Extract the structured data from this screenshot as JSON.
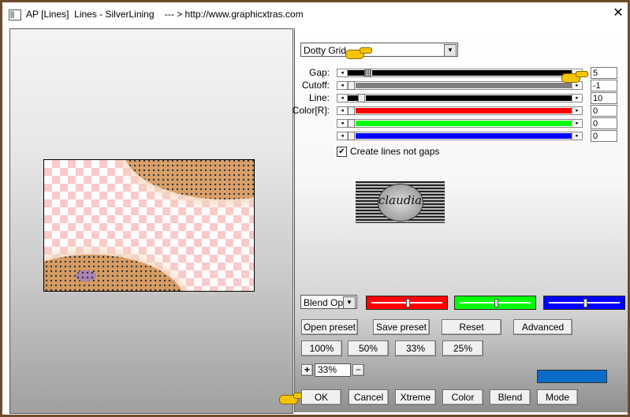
{
  "window": {
    "title": "AP [Lines]  Lines - SilverLining    --- > http://www.graphicxtras.com",
    "close_glyph": "✕"
  },
  "effect_select": {
    "value": "Dotty Grid"
  },
  "sliders": [
    {
      "label": "Gap:",
      "value": "5",
      "fill_color": "#000000",
      "position": 0.08
    },
    {
      "label": "Cutoff:",
      "value": "-1",
      "fill_color": "#808080",
      "position": 0.0
    },
    {
      "label": "Line:",
      "value": "10",
      "fill_color": "#000000",
      "position": 0.05
    },
    {
      "label": "Color[R]:",
      "value": "0",
      "fill_color": "#ff0000",
      "position": 0.0
    },
    {
      "label": "",
      "value": "0",
      "fill_color": "#00ff00",
      "position": 0.0
    },
    {
      "label": "",
      "value": "0",
      "fill_color": "#0000ff",
      "position": 0.0
    }
  ],
  "checkbox": {
    "label": "Create lines not gaps",
    "checked": true,
    "check_glyph": "✔"
  },
  "logo": {
    "text": "claudia"
  },
  "blend": {
    "select_value": "Blend Optic",
    "mini_sliders": [
      {
        "color": "#ff0000",
        "position": 0.5
      },
      {
        "color": "#00ff00",
        "position": 0.5
      },
      {
        "color": "#0000ff",
        "position": 0.5
      }
    ]
  },
  "buttons": {
    "open_preset": "Open preset",
    "save_preset": "Save preset",
    "reset": "Reset",
    "advanced": "Advanced",
    "zoom_100": "100%",
    "zoom_50": "50%",
    "zoom_33": "33%",
    "zoom_25": "25%",
    "zoom_plus": "+",
    "zoom_minus": "−",
    "ok": "OK",
    "cancel": "Cancel",
    "xtreme": "Xtreme",
    "color": "Color",
    "blend": "Blend",
    "mode": "Mode"
  },
  "zoom": {
    "value": "33%"
  },
  "color_swatch": "#0a6cc8",
  "icons": {
    "hand": "pointing-hand-icon",
    "dropdown": "chevron-down-icon"
  }
}
